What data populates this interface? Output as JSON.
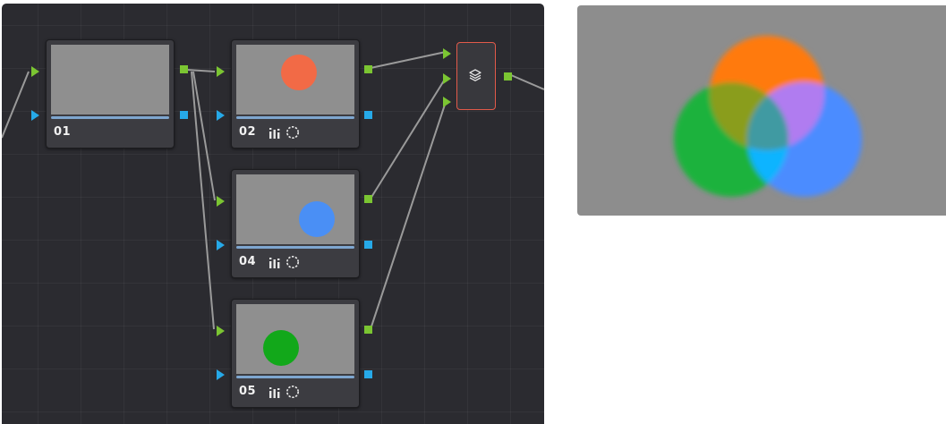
{
  "node_graph": {
    "nodes": [
      {
        "label": "01",
        "dot_color": null,
        "has_icons": false
      },
      {
        "label": "02",
        "dot_color": "#f26a46",
        "has_icons": true
      },
      {
        "label": "04",
        "dot_color": "#4a8ff5",
        "has_icons": true
      },
      {
        "label": "05",
        "dot_color": "#12a81a",
        "has_icons": true
      }
    ],
    "layer_mixer": {
      "icon": "layers-icon"
    },
    "colors": {
      "rgb_input": "#7bc532",
      "alpha_input": "#26a9e8",
      "selected_outline": "#e25a4a"
    }
  },
  "viewer": {
    "circles": [
      {
        "name": "orange",
        "color": "#ff7a10"
      },
      {
        "name": "green",
        "color": "#1ab23c"
      },
      {
        "name": "blue",
        "color": "#4b8cff"
      }
    ],
    "overlaps": [
      "#b07cf0",
      "#8a9d1e",
      "#0ab4ff",
      "#3f9aa2"
    ]
  }
}
